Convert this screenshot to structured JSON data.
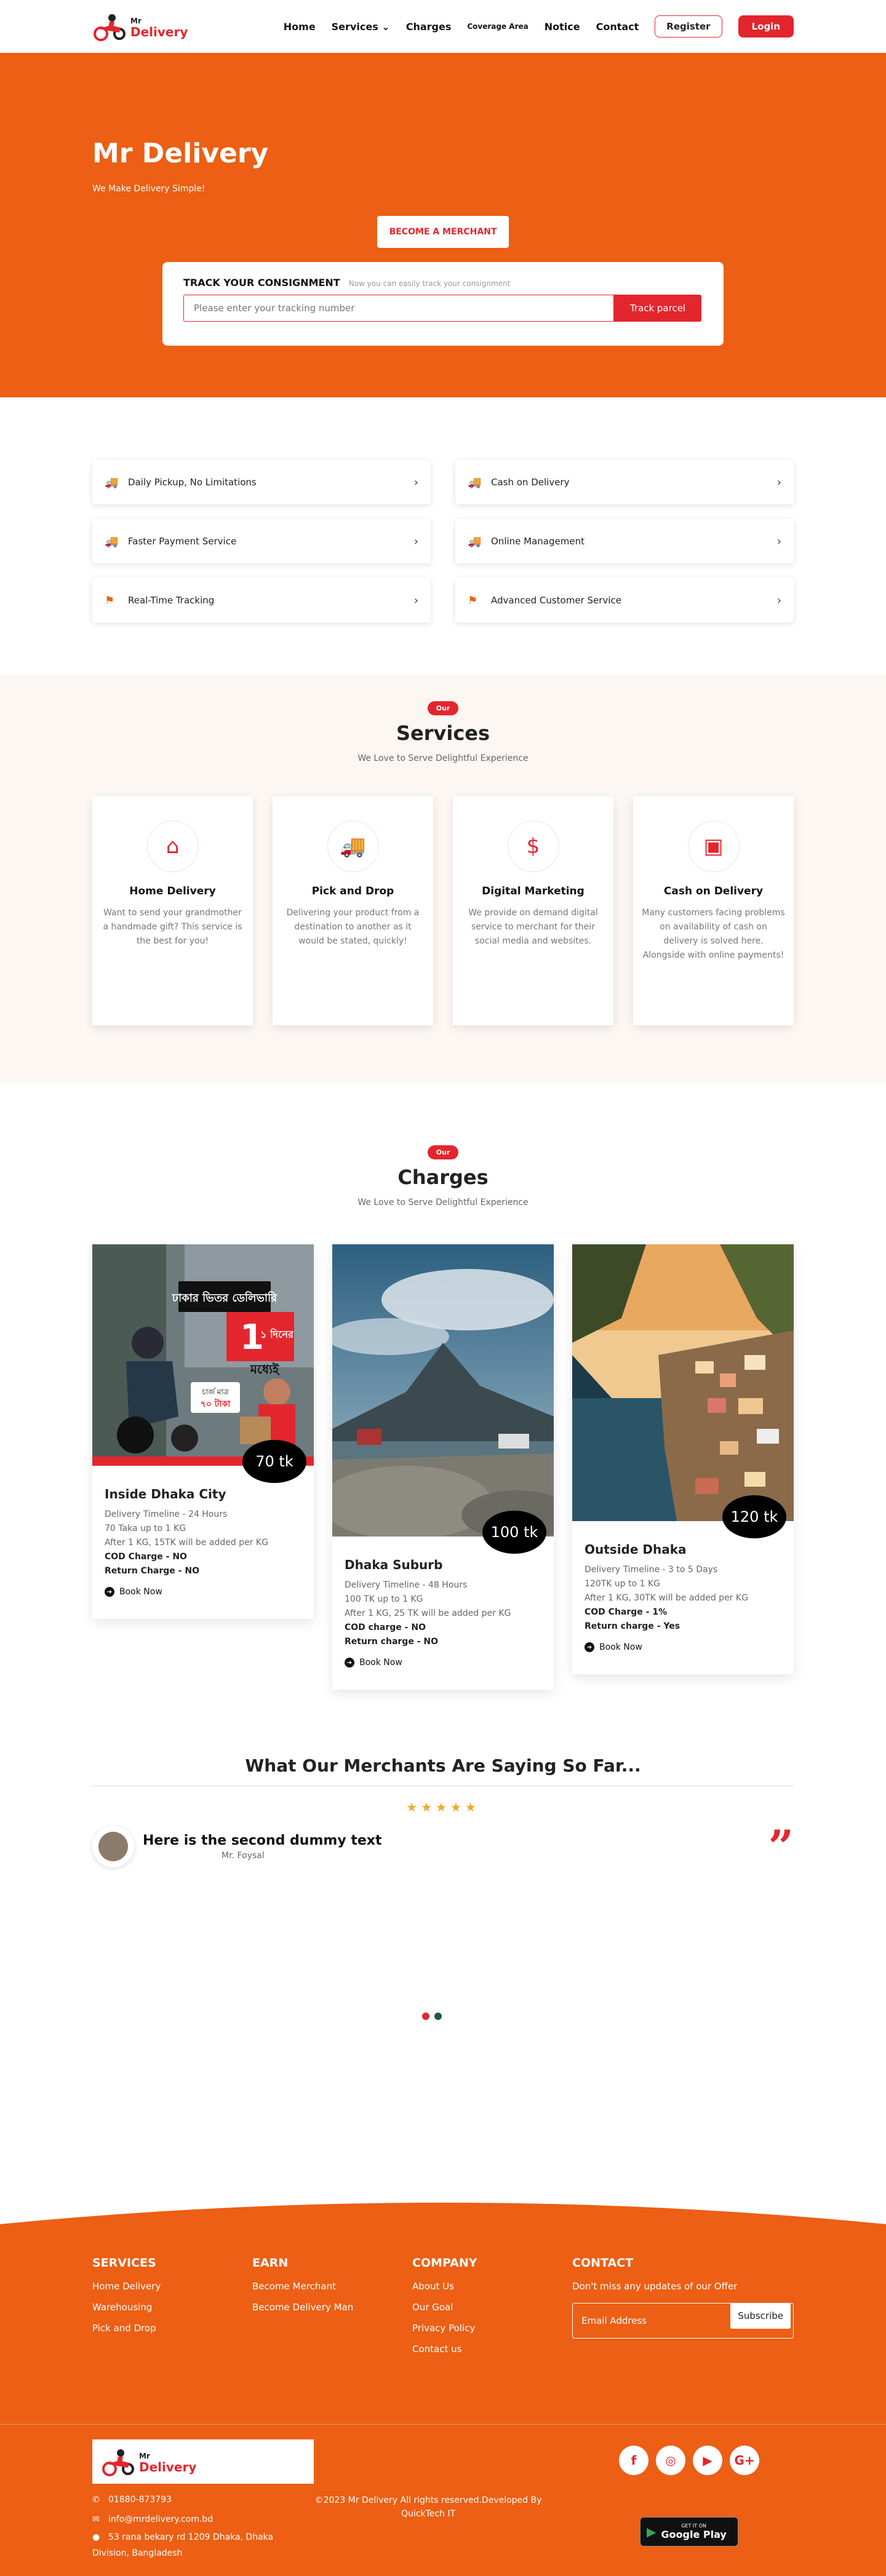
{
  "nav": {
    "logo_top": "Mr",
    "logo_name": "Delivery",
    "links": [
      "Home",
      "Services",
      "Charges",
      "Coverage Area",
      "Notice",
      "Contact"
    ],
    "register": "Register",
    "login": "Login"
  },
  "hero": {
    "title": "Mr Delivery",
    "subtitle": "We Make Delivery Simple!",
    "merchant_button": "BECOME A MERCHANT",
    "track_title": "TRACK YOUR CONSIGNMENT",
    "track_note": "Now you can easily track your consignment",
    "track_placeholder": "Please enter your tracking number",
    "track_button": "Track parcel"
  },
  "features": [
    {
      "label": "Daily Pickup, No Limitations",
      "icon": "truck-icon"
    },
    {
      "label": "Cash on Delivery",
      "icon": "truck-icon"
    },
    {
      "label": "Faster Payment Service",
      "icon": "truck-icon"
    },
    {
      "label": "Online Management",
      "icon": "truck-icon"
    },
    {
      "label": "Real-Time Tracking",
      "icon": "flag-icon"
    },
    {
      "label": "Advanced Customer Service",
      "icon": "flag-icon"
    }
  ],
  "services": {
    "pill": "Our",
    "title": "Services",
    "subtitle": "We Love to Serve Delightful Experience",
    "items": [
      {
        "title": "Home Delivery",
        "text": "Want to send your grandmother a handmade gift? This service is the best for you!",
        "icon": "home-icon"
      },
      {
        "title": "Pick and Drop",
        "text": "Delivering your product from a destination to another as it would be stated, quickly!",
        "icon": "truck-icon"
      },
      {
        "title": "Digital Marketing",
        "text": "We provide on demand digital service to merchant for their social media and websites.",
        "icon": "dollar-icon"
      },
      {
        "title": "Cash on Delivery",
        "text": "Many customers facing problems on availability of cash on delivery is solved here. Alongside with online payments!",
        "icon": "cash-icon"
      }
    ]
  },
  "charges": {
    "pill": "Our",
    "title": "Charges",
    "subtitle": "We Love to Serve Delightful Experience",
    "cards": [
      {
        "price": "70 tk",
        "title": "Inside Dhaka City",
        "lines": [
          "Delivery Timeline - 24 Hours",
          "70 Taka up to 1 KG",
          "After 1 KG, 15TK will be added per KG"
        ],
        "bold": [
          "COD Charge - NO",
          "Return Charge - NO"
        ],
        "book": "Book Now",
        "banner_text": "ঢাকার ভিতর ডেলিভারি",
        "banner_day": "১ দিনের",
        "banner_within": "মধ্যেই",
        "banner_price_label": "চার্জ মাত্র",
        "banner_price": "৭০ টাকা"
      },
      {
        "price": "100 tk",
        "title": "Dhaka Suburb",
        "lines": [
          "Delivery Timeline - 48 Hours",
          "100 TK up to 1 KG",
          "After 1 KG, 25 TK will be added per KG"
        ],
        "bold": [
          "COD charge - NO",
          "Return charge - NO"
        ],
        "book": "Book Now"
      },
      {
        "price": "120 tk",
        "title": "Outside Dhaka",
        "lines": [
          "Delivery Timeline - 3 to 5 Days",
          "120TK up to 1 KG",
          "After 1 KG, 30TK will be added per KG"
        ],
        "bold": [
          "COD Charge - 1%",
          "Return charge - Yes"
        ],
        "book": "Book Now"
      }
    ]
  },
  "testimonials": {
    "title": "What Our Merchants Are Saying So Far...",
    "stars": "★★★★★",
    "quote": "Here is the second dummy text",
    "author": "Mr. Foysal"
  },
  "footer": {
    "services_title": "SERVICES",
    "services": [
      "Home Delivery",
      "Warehousing",
      "Pick and Drop"
    ],
    "earn_title": "EARN",
    "earn": [
      "Become Merchant",
      "Become Delivery Man"
    ],
    "company_title": "COMPANY",
    "company": [
      "About Us",
      "Our Goal",
      "Privacy Policy",
      "Contact us"
    ],
    "contact_title": "CONTACT",
    "contact_note": "Don't miss any updates of our Offer",
    "email_placeholder": "Email Address",
    "subscribe": "Subscribe",
    "phone": "01880-873793",
    "email": "info@mrdelivery.com.bd",
    "address": "53 rana bekary rd 1209 Dhaka, Dhaka Division, Bangladesh",
    "copyright": "©2023 Mr Delivery All rights reserved.Developed By QuickTech IT",
    "gplay_small": "GET IT ON",
    "gplay": "Google Play"
  },
  "colors": {
    "brand_orange": "#ec5f14",
    "brand_red": "#e3262e"
  }
}
